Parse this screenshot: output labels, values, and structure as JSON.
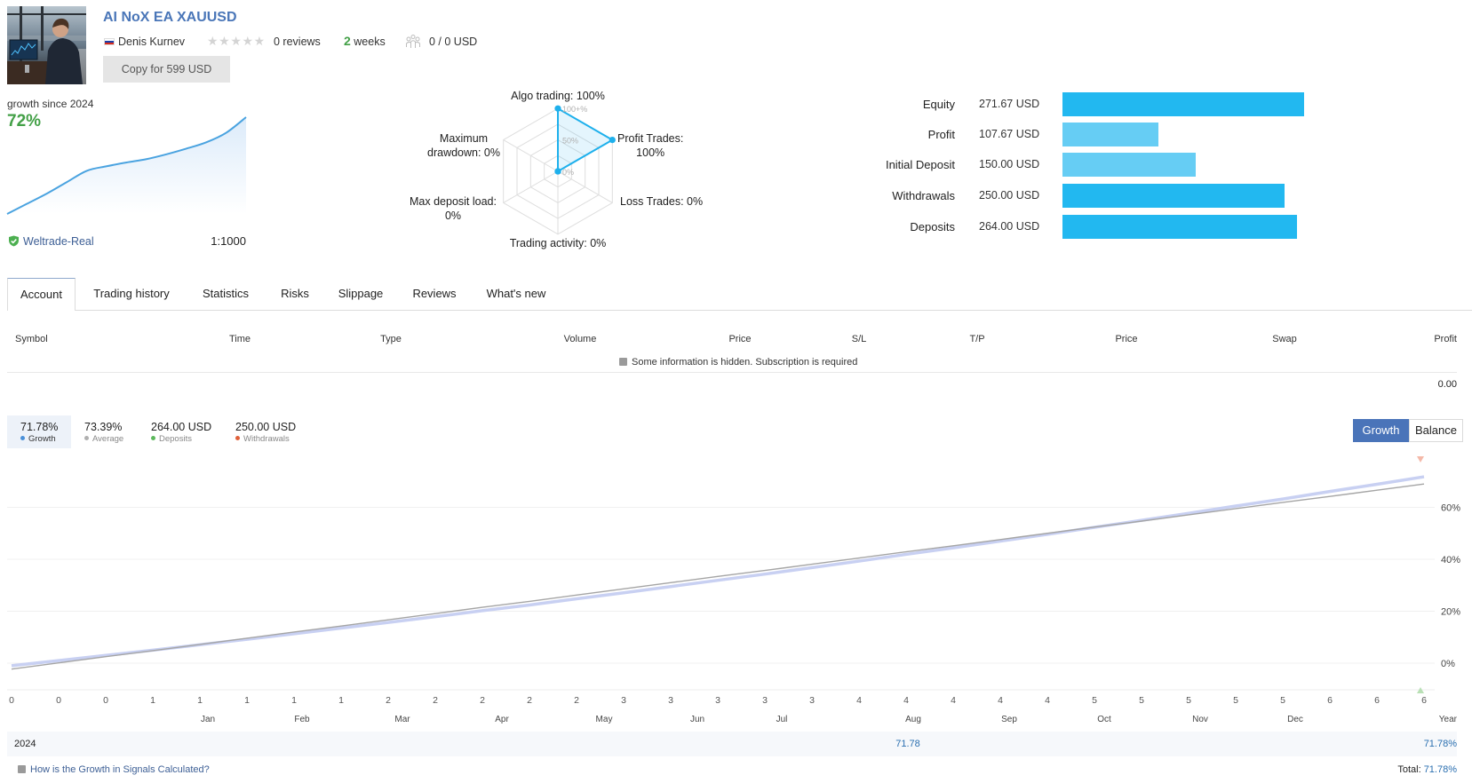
{
  "header": {
    "title": "AI NoX EA XAUUSD",
    "author": "Denis Kurnev",
    "author_country": "Russia",
    "rating_stars": 0,
    "rating_max": 5,
    "reviews": "0 reviews",
    "age_number": "2",
    "age_unit": "weeks",
    "subscribers": "0 / 0 USD",
    "copy_button": "Copy for 599 USD"
  },
  "growth_summary": {
    "label": "growth since 2024",
    "value": "72%",
    "broker": "Weltrade-Real",
    "leverage": "1:1000"
  },
  "tabs": [
    {
      "label": "Account",
      "active": true
    },
    {
      "label": "Trading history",
      "active": false
    },
    {
      "label": "Statistics",
      "active": false
    },
    {
      "label": "Risks",
      "active": false
    },
    {
      "label": "Slippage",
      "active": false
    },
    {
      "label": "Reviews",
      "active": false
    },
    {
      "label": "What's new",
      "active": false
    }
  ],
  "positions_table": {
    "columns": [
      "Symbol",
      "Time",
      "Type",
      "Volume",
      "Price",
      "S/L",
      "T/P",
      "Price",
      "Swap",
      "Profit"
    ],
    "notice": "Some information is hidden. Subscription is required",
    "total_profit": "0.00"
  },
  "stats": [
    {
      "value": "71.78%",
      "label": "Growth",
      "dot_color": "#4a90d9",
      "active": true
    },
    {
      "value": "73.39%",
      "label": "Average",
      "dot_color": "#b0b0b0",
      "active": false
    },
    {
      "value": "264.00 USD",
      "label": "Deposits",
      "dot_color": "#5cb85c",
      "active": false
    },
    {
      "value": "250.00 USD",
      "label": "Withdrawals",
      "dot_color": "#e0603a",
      "active": false
    }
  ],
  "chart_toggle": {
    "options": [
      "Growth",
      "Balance"
    ],
    "selected": "Growth"
  },
  "year_table": {
    "months": [
      "Jan",
      "Feb",
      "Mar",
      "Apr",
      "May",
      "Jun",
      "Jul",
      "Aug",
      "Sep",
      "Oct",
      "Nov",
      "Dec"
    ],
    "year_header": "Year",
    "rows": [
      {
        "year": "2024",
        "months": [
          "",
          "",
          "",
          "",
          "",
          "",
          "",
          "71.78",
          "",
          "",
          "",
          ""
        ],
        "year_total": "71.78%"
      }
    ],
    "footer_link": "How is the Growth in Signals Calculated?",
    "total_label": "Total:",
    "total_value": "71.78%"
  },
  "colors": {
    "title": "#4a76b8",
    "accent": "#4a74b9",
    "positive": "#43a047",
    "bar_dark": "#22b8f0",
    "bar_light": "#66cdf4",
    "radar": "#1eb0ec",
    "growth_line": "#c8d0f2",
    "average_line": "#a5a5a5",
    "mini_line": "#4aa3e0"
  },
  "chart_data": [
    {
      "type": "line",
      "title": "Growth",
      "x": [
        0,
        0,
        0,
        1,
        1,
        1,
        1,
        1,
        2,
        2,
        2,
        2,
        2,
        3,
        3,
        3,
        3,
        3,
        4,
        4,
        4,
        4,
        4,
        5,
        5,
        5,
        5,
        5,
        6,
        6,
        6
      ],
      "series": [
        {
          "name": "Growth",
          "values": [
            -1.0,
            1.0,
            3.0,
            5.0,
            7.1,
            9.2,
            11.3,
            13.5,
            15.7,
            17.9,
            20.2,
            22.4,
            24.8,
            27.1,
            29.5,
            31.9,
            34.3,
            36.8,
            39.3,
            41.9,
            44.4,
            47.0,
            49.6,
            52.3,
            55.0,
            57.7,
            60.5,
            63.2,
            66.1,
            68.9,
            71.78
          ]
        },
        {
          "name": "Average",
          "values": [
            -2.3,
            0.1,
            2.5,
            4.8,
            7.2,
            9.6,
            12.0,
            14.3,
            16.7,
            19.1,
            21.5,
            23.8,
            26.2,
            28.6,
            31.0,
            33.4,
            35.7,
            38.1,
            40.5,
            42.9,
            45.2,
            47.6,
            50.0,
            52.4,
            54.7,
            57.1,
            59.5,
            61.9,
            64.2,
            66.6,
            69.0
          ]
        }
      ],
      "yticks": [
        0,
        20,
        40,
        60
      ],
      "ytick_labels": [
        "0%",
        "20%",
        "40%",
        "60%"
      ],
      "ylim": [
        -10,
        84
      ],
      "yaxis_side": "right",
      "grid": true,
      "markers": [
        {
          "kind": "withdrawal",
          "index": 30,
          "color": "#f4b9a9"
        },
        {
          "kind": "deposit",
          "index": 30,
          "color": "#b9e0b5"
        }
      ]
    },
    {
      "type": "bar",
      "orientation": "horizontal",
      "categories": [
        "Equity",
        "Profit",
        "Initial Deposit",
        "Withdrawals",
        "Deposits"
      ],
      "values": [
        271.67,
        107.67,
        150.0,
        250.0,
        264.0
      ],
      "value_labels": [
        "271.67 USD",
        "107.67 USD",
        "150.00 USD",
        "250.00 USD",
        "264.00 USD"
      ],
      "bar_colors": [
        "#22b8f0",
        "#66cdf4",
        "#66cdf4",
        "#22b8f0",
        "#22b8f0"
      ]
    },
    {
      "type": "radar",
      "axes": [
        {
          "name": "Algo trading",
          "value": 100,
          "lines": [
            "Algo trading: 100%"
          ]
        },
        {
          "name": "Profit Trades",
          "value": 100,
          "lines": [
            "Profit Trades:",
            "100%"
          ]
        },
        {
          "name": "Loss Trades",
          "value": 0,
          "lines": [
            "Loss Trades: 0%"
          ]
        },
        {
          "name": "Trading activity",
          "value": 0,
          "lines": [
            "Trading activity: 0%"
          ]
        },
        {
          "name": "Max deposit load",
          "value": 0,
          "lines": [
            "Max deposit load:",
            "0%"
          ]
        },
        {
          "name": "Maximum drawdown",
          "value": 0,
          "lines": [
            "Maximum",
            "drawdown: 0%"
          ]
        }
      ],
      "scale_labels": [
        "100+%",
        "50%",
        "0%"
      ],
      "max": 100
    },
    {
      "type": "area",
      "title": "growth since 2024",
      "values": [
        0,
        7.6,
        15.2,
        23.7,
        32.1,
        35.5,
        38.3,
        40.8,
        44.4,
        48.6,
        53.3,
        60.4,
        72
      ],
      "ylim": [
        0,
        72
      ]
    }
  ]
}
